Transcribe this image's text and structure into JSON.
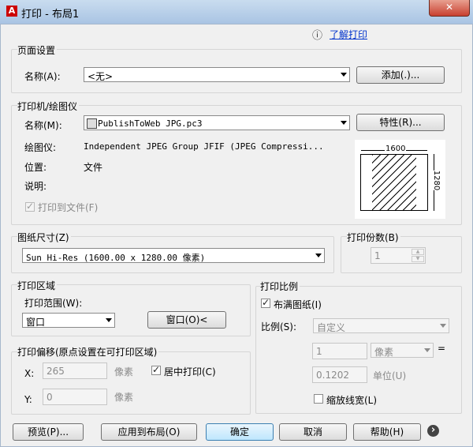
{
  "window": {
    "title": "打印 - 布局1",
    "close": "✕"
  },
  "help": {
    "icon": "ⓘ",
    "link": "了解打印"
  },
  "page_setup": {
    "group": "页面设置",
    "name_label": "名称(A):",
    "name_value": "<无>",
    "add_button": "添加(.)..."
  },
  "printer": {
    "group": "打印机/绘图仪",
    "name_label": "名称(M):",
    "name_value": "PublishToWeb JPG.pc3",
    "properties_button": "特性(R)...",
    "plotter_label": "绘图仪:",
    "plotter_value": "Independent JPEG Group JFIF (JPEG Compressi...",
    "location_label": "位置:",
    "location_value": "文件",
    "description_label": "说明:",
    "print_to_file": "打印到文件(F)",
    "preview_width": "1600",
    "preview_height": "1280"
  },
  "paper": {
    "group": "图纸尺寸(Z)",
    "value": "Sun Hi-Res (1600.00 x 1280.00 像素)"
  },
  "copies": {
    "group": "打印份数(B)",
    "value": "1"
  },
  "area": {
    "group": "打印区域",
    "range_label": "打印范围(W):",
    "range_value": "窗口",
    "window_button": "窗口(O)<"
  },
  "offset": {
    "group": "打印偏移(原点设置在可打印区域)",
    "x_label": "X:",
    "x_value": "265",
    "x_unit": "像素",
    "y_label": "Y:",
    "y_value": "0",
    "y_unit": "像素",
    "center": "居中打印(C)"
  },
  "scale": {
    "group": "打印比例",
    "fit": "布满图纸(I)",
    "scale_label": "比例(S):",
    "scale_value": "自定义",
    "v1": "1",
    "unit1": "像素",
    "eq": "=",
    "v2": "0.1202",
    "unit2": "单位(U)",
    "lineweights": "缩放线宽(L)"
  },
  "buttons": {
    "preview": "预览(P)...",
    "apply": "应用到布局(O)",
    "ok": "确定",
    "cancel": "取消",
    "help": "帮助(H)",
    "more": "›"
  }
}
